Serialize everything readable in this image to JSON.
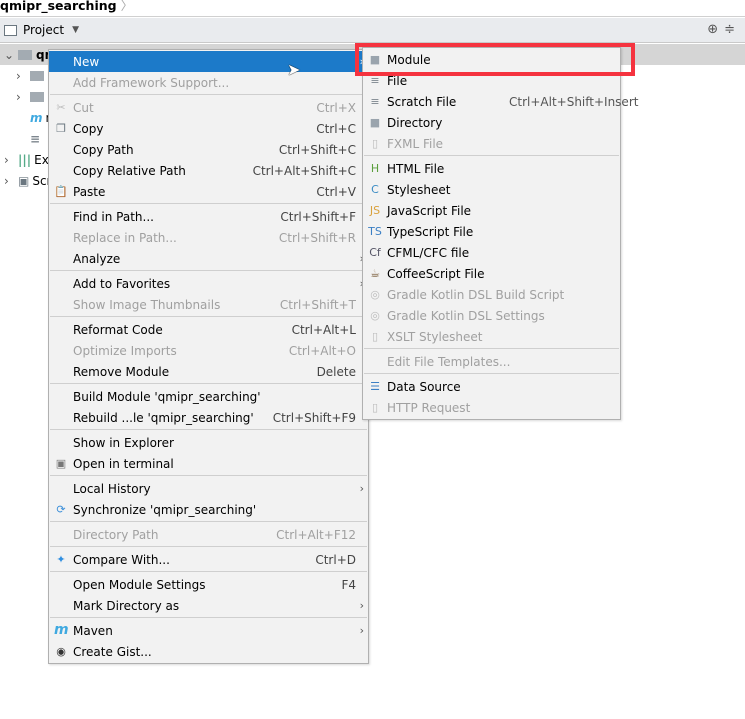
{
  "breadcrumb": {
    "project": "qmipr_searching",
    "separator": "〉"
  },
  "toolbar": {
    "view": "Project",
    "icons": [
      "globe-icon",
      "collapse-icon"
    ]
  },
  "tree": [
    {
      "label": "qm",
      "selected": true,
      "expanded": true
    },
    {
      "label": "",
      "arrow": "›"
    },
    {
      "label": "",
      "arrow": "›"
    },
    {
      "label": "m",
      "icon": "maven-icon"
    },
    {
      "label": "",
      "icon": "file-icon"
    },
    {
      "label": "Ext",
      "icon": "libraries-icon",
      "arrow": "›"
    },
    {
      "label": "Scr",
      "icon": "scratches-icon",
      "arrow": "›"
    }
  ],
  "context_menu": [
    {
      "label": "New",
      "highlighted": true,
      "submenu": true
    },
    {
      "label": "Add Framework Support...",
      "disabled": true
    },
    {
      "sep": true
    },
    {
      "label": "Cut",
      "shortcut": "Ctrl+X",
      "disabled": true,
      "icon": "scissors-icon"
    },
    {
      "label": "Copy",
      "shortcut": "Ctrl+C",
      "icon": "copy-icon"
    },
    {
      "label": "Copy Path",
      "shortcut": "Ctrl+Shift+C"
    },
    {
      "label": "Copy Relative Path",
      "shortcut": "Ctrl+Alt+Shift+C"
    },
    {
      "label": "Paste",
      "shortcut": "Ctrl+V",
      "icon": "paste-icon"
    },
    {
      "sep": true
    },
    {
      "label": "Find in Path...",
      "shortcut": "Ctrl+Shift+F"
    },
    {
      "label": "Replace in Path...",
      "shortcut": "Ctrl+Shift+R",
      "disabled": true
    },
    {
      "label": "Analyze",
      "submenu": true
    },
    {
      "sep": true
    },
    {
      "label": "Add to Favorites",
      "submenu": true
    },
    {
      "label": "Show Image Thumbnails",
      "shortcut": "Ctrl+Shift+T",
      "disabled": true
    },
    {
      "sep": true
    },
    {
      "label": "Reformat Code",
      "shortcut": "Ctrl+Alt+L"
    },
    {
      "label": "Optimize Imports",
      "shortcut": "Ctrl+Alt+O",
      "disabled": true
    },
    {
      "label": "Remove Module",
      "shortcut": "Delete"
    },
    {
      "sep": true
    },
    {
      "label": "Build Module 'qmipr_searching'"
    },
    {
      "label": "Rebuild ...le 'qmipr_searching'",
      "shortcut": "Ctrl+Shift+F9"
    },
    {
      "sep": true
    },
    {
      "label": "Show in Explorer"
    },
    {
      "label": "Open in terminal",
      "icon": "terminal-icon"
    },
    {
      "sep": true
    },
    {
      "label": "Local History",
      "submenu": true
    },
    {
      "label": "Synchronize 'qmipr_searching'",
      "icon": "sync-icon"
    },
    {
      "sep": true
    },
    {
      "label": "Directory Path",
      "shortcut": "Ctrl+Alt+F12",
      "disabled": true
    },
    {
      "sep": true
    },
    {
      "label": "Compare With...",
      "shortcut": "Ctrl+D",
      "icon": "compare-icon"
    },
    {
      "sep": true
    },
    {
      "label": "Open Module Settings",
      "shortcut": "F4"
    },
    {
      "label": "Mark Directory as",
      "submenu": true
    },
    {
      "sep": true
    },
    {
      "label": "Maven",
      "submenu": true,
      "icon": "maven-icon"
    },
    {
      "label": "Create Gist...",
      "icon": "github-icon"
    }
  ],
  "new_submenu": [
    {
      "label": "Module",
      "icon": "module-icon",
      "boxed": true
    },
    {
      "label": "File",
      "icon": "file-icon"
    },
    {
      "label": "Scratch File",
      "shortcut": "Ctrl+Alt+Shift+Insert",
      "icon": "scratch-file-icon"
    },
    {
      "label": "Directory",
      "icon": "folder-icon"
    },
    {
      "label": "FXML File",
      "disabled": true,
      "icon": "fxml-icon"
    },
    {
      "sep": true
    },
    {
      "label": "HTML File",
      "icon": "html-icon"
    },
    {
      "label": "Stylesheet",
      "icon": "css-icon"
    },
    {
      "label": "JavaScript File",
      "icon": "js-icon"
    },
    {
      "label": "TypeScript File",
      "icon": "ts-icon"
    },
    {
      "label": "CFML/CFC file",
      "icon": "cfml-icon"
    },
    {
      "label": "CoffeeScript File",
      "icon": "coffeescript-icon"
    },
    {
      "label": "Gradle Kotlin DSL Build Script",
      "disabled": true,
      "icon": "gradle-icon"
    },
    {
      "label": "Gradle Kotlin DSL Settings",
      "disabled": true,
      "icon": "gradle-icon"
    },
    {
      "label": "XSLT Stylesheet",
      "disabled": true,
      "icon": "xslt-icon"
    },
    {
      "sep": true
    },
    {
      "label": "Edit File Templates...",
      "disabled": true
    },
    {
      "sep": true
    },
    {
      "label": "Data Source",
      "icon": "database-icon"
    },
    {
      "label": "HTTP Request",
      "disabled": true,
      "icon": "http-icon"
    }
  ],
  "colors": {
    "highlight": "#1c7ac9",
    "menu_bg": "#f2f2f2",
    "annotation_box": "#f5333f"
  }
}
